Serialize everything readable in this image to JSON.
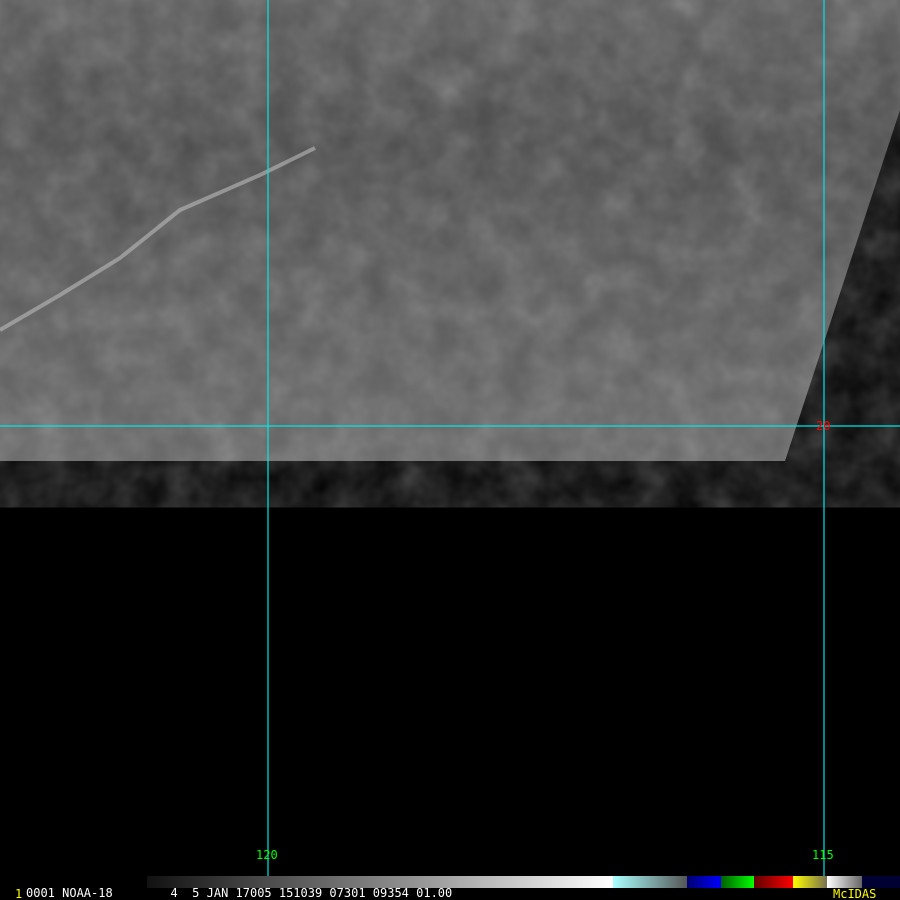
{
  "satellite_image": {
    "frame_number": "1",
    "caption": "0001 NOAA-18        4  5 JAN 17005 151039 07301 09354 01.00",
    "software_label": "McIDAS"
  },
  "grid": {
    "lon_labels": [
      "120",
      "115"
    ],
    "lat_labels": [
      "20"
    ],
    "grid_color": "#00e5e5",
    "lon_label_color": "#00ff00",
    "lat_label_color": "#ff0000"
  },
  "colorbar": {
    "segments": [
      "grayscale",
      "cyan",
      "blue",
      "green",
      "red",
      "yellow",
      "white-gray",
      "navy"
    ]
  }
}
